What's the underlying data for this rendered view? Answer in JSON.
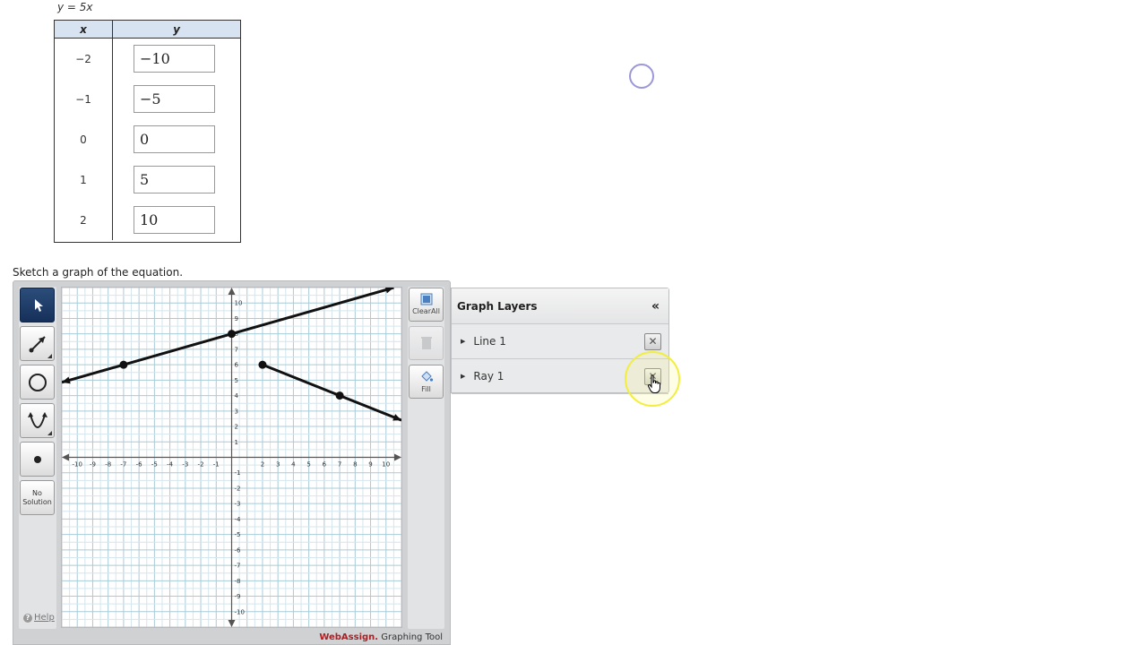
{
  "problem": {
    "equation": "y = 5x",
    "prompt": "Sketch a graph of the equation."
  },
  "table": {
    "x_header": "x",
    "y_header": "y",
    "rows": [
      {
        "x": "−2",
        "y": "−10"
      },
      {
        "x": "−1",
        "y": "−5"
      },
      {
        "x": "0",
        "y": "0"
      },
      {
        "x": "1",
        "y": "5"
      },
      {
        "x": "2",
        "y": "10"
      }
    ]
  },
  "toolbar": {
    "tools": [
      "pointer-icon",
      "line-tool-icon",
      "circle-tool-icon",
      "parabola-tool-icon",
      "point-tool-icon"
    ],
    "active_tool": "pointer-icon",
    "no_solution_line1": "No",
    "no_solution_line2": "Solution",
    "help_label": "Help",
    "clear_all_label": "ClearAll",
    "fill_label": "Fill"
  },
  "graph": {
    "x_range": [
      -11,
      11
    ],
    "y_range": [
      -11,
      11
    ],
    "x_tick_labels": [
      "-10",
      "-9",
      "-8",
      "-7",
      "-6",
      "-5",
      "-4",
      "-3",
      "-2",
      "-1",
      "2",
      "3",
      "4",
      "5",
      "6",
      "7",
      "8",
      "9",
      "10"
    ],
    "y_tick_labels": [
      "10",
      "9",
      "8",
      "7",
      "6",
      "5",
      "4",
      "3",
      "2",
      "1",
      "-1",
      "-2",
      "-3",
      "-4",
      "-5",
      "-6",
      "-7",
      "-8",
      "-9",
      "-10"
    ],
    "line": {
      "points": [
        [
          -7,
          6
        ],
        [
          0,
          8
        ]
      ]
    },
    "ray": {
      "start": [
        2,
        6
      ],
      "through": [
        7,
        4
      ]
    }
  },
  "layers": {
    "title": "Graph Layers",
    "collapse_glyph": "«",
    "items": [
      {
        "name": "Line 1"
      },
      {
        "name": "Ray 1"
      }
    ]
  },
  "footer": {
    "brand": "WebAssign.",
    "product": " Graphing Tool"
  },
  "colors": {
    "table_header": "#d7e3f0",
    "active_tool": "#1d3a66",
    "brand_red": "#b01e23",
    "highlight_yellow": "#f2ee3e",
    "loading_ring": "#9b97d8"
  }
}
